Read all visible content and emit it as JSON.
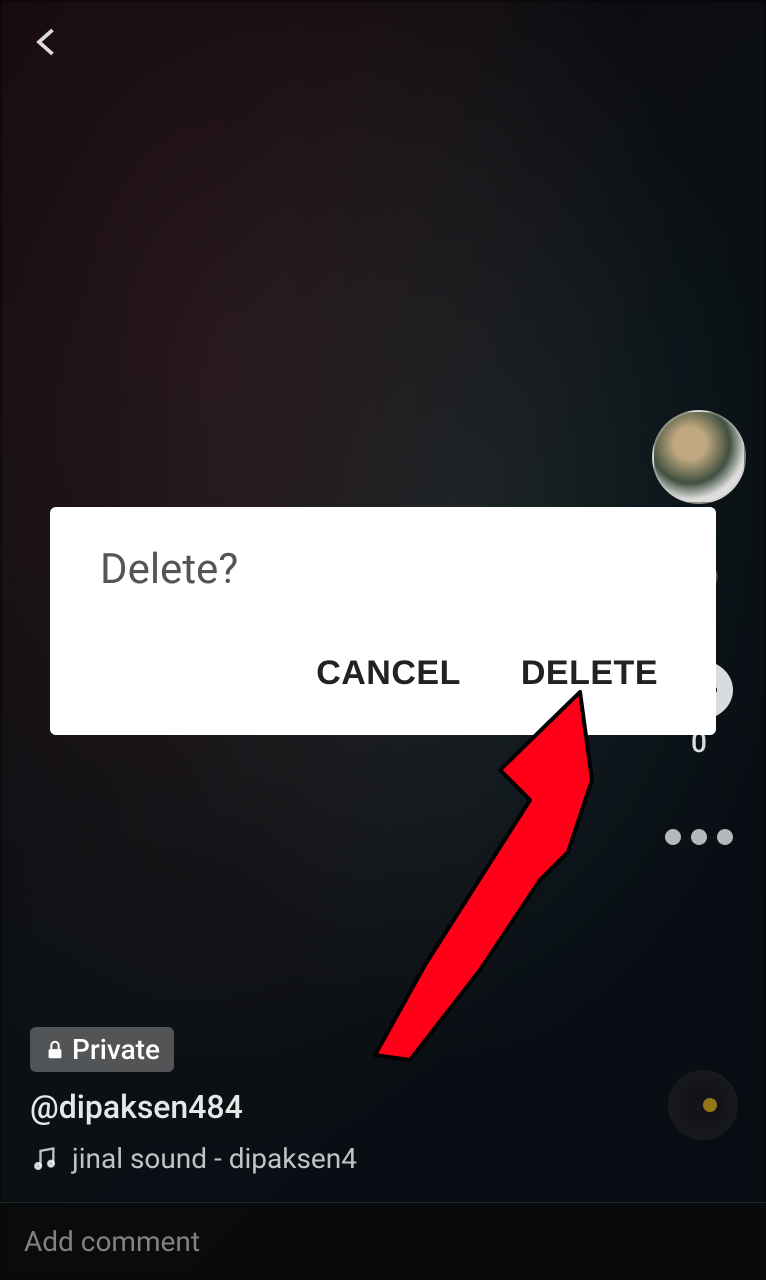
{
  "modal": {
    "title": "Delete?",
    "cancel_label": "CANCEL",
    "delete_label": "DELETE"
  },
  "sidebar": {
    "comment_count": "0"
  },
  "video_info": {
    "privacy_label": "Private",
    "username": "@dipaksen484",
    "sound_text": "jinal sound - dipaksen4"
  },
  "comment_input": {
    "placeholder": "Add comment"
  }
}
